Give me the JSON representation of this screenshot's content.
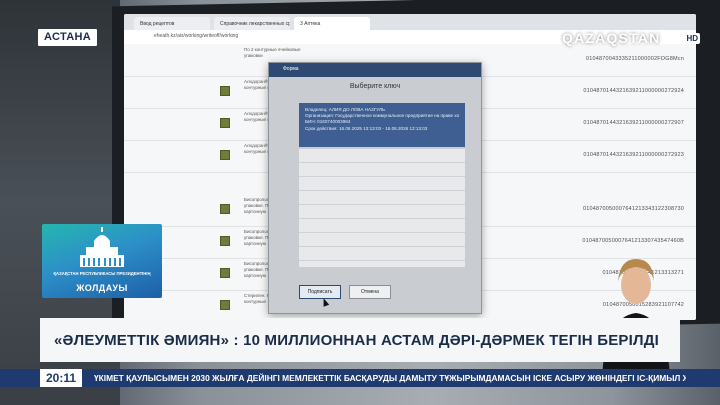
{
  "overlay": {
    "city": "АСТАНА",
    "channel": "QAZAQSTAN",
    "channel_hd": "HD",
    "ribbon_top": "ҚАЗАҚСТАН РЕСПУБЛИКАСЫ ПРЕЗИДЕНТІНІҢ",
    "ribbon_main": "ЖОЛДАУЫ",
    "headline": "«ӘЛЕУМЕТТІК ӘМИЯН» : 10 МИЛЛИОННАН АСТАМ ДӘРІ-ДӘРМЕК ТЕГІН БЕРІЛДІ",
    "clock": "20:11",
    "ticker": "ҮКІМЕТ ҚАУЛЫСЫМЕН 2030 ЖЫЛҒА ДЕЙІНГІ МЕМЛЕКЕТТІК БАСҚАРУДЫ ДАМЫТУ ТҰЖЫРЫМДАМАСЫН ІСКЕ АСЫРУ ЖӨНІНДЕГІ ІС-ҚИМЫЛ ЖОСПАРЫНА ӨЗГЕРІСТЕР ЕНГІЗІЛДІ"
  },
  "browser": {
    "tabs": [
      "Ввод рецептов",
      "Справочник лекарственных средств",
      "3 Аптека"
    ],
    "url": "eheath.kz/ais/working/writeoff/working"
  },
  "rows": [
    {
      "desc": "По 2 контурные ячейковые упаковки",
      "code": "0104870043335211000002FOG8Mcn"
    },
    {
      "desc": "Алодорон®. По 10 капсул. По 2 контурные ячейковые",
      "code": "0104870144321639211000000272924"
    },
    {
      "desc": "Алодорон®. По 10 капсул. По 3 контурные ячейковые",
      "code": "0104870144321639211000000272907"
    },
    {
      "desc": "Алодорон®. По 10 капсул. По 3 контурные ячейковые",
      "code": "0104870144321639211000000272923"
    },
    {
      "desc": "Бисопролол. По 10 таблеток. упаковке. По 3 контурные картонную",
      "code": "0104870050007641213343122308730"
    },
    {
      "desc": "Бисопролол. По 10 таблеток. упаковке. По 3 контурные картонную",
      "code": "010487005000764121330743547460B"
    },
    {
      "desc": "Бисопролол. По 10 таблеток. упаковке. По 3 контурные картонную",
      "code": "0104870050007641213313271"
    },
    {
      "desc": "Стерилен. По 10 таблеток. По 3 контурные",
      "code": "0104870050015283921107742"
    }
  ],
  "dialog": {
    "title": "Форма",
    "heading": "Выберите ключ",
    "cert_lines": [
      "Владелец: АЛИЯ ДО ЛОВА НАЗГУЛЬ",
      "Организация: Государственное коммунальное предприятие на праве хо",
      "БИН: 0160740003984",
      "Срок действия: 16.06.2025 13:13:03 - 16.06.2026 13:13:03"
    ],
    "sign_label": "Подписать",
    "cancel_label": "Отмена"
  }
}
